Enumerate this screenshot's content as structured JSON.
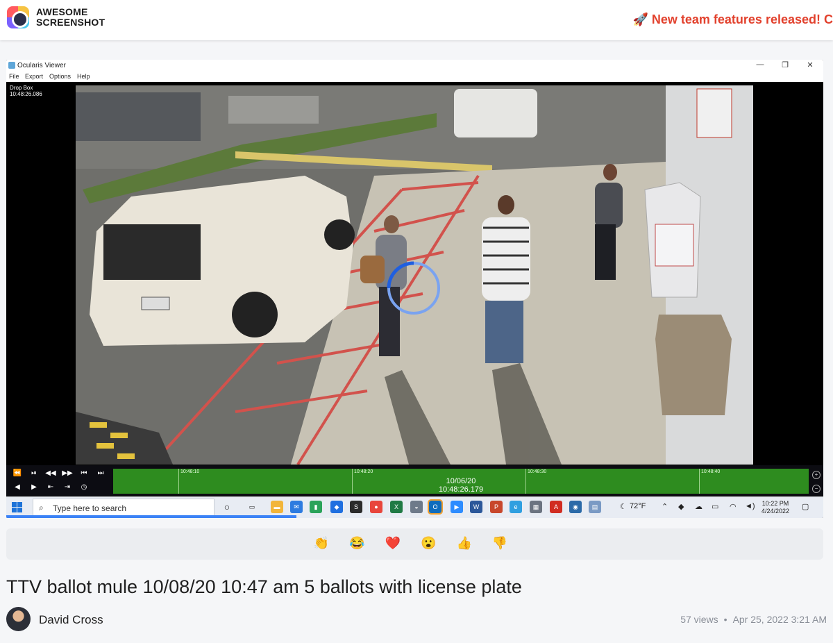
{
  "header": {
    "brand": "AWESOME\nSCREENSHOT",
    "promo": "🚀 New team features released! C"
  },
  "viewer_window": {
    "title": "Ocularis Viewer",
    "menu": [
      "File",
      "Export",
      "Options",
      "Help"
    ],
    "camera_label": "Drop Box\n10:48:26.086",
    "timeline": {
      "ticks": [
        "10:48:10",
        "10:48:20",
        "10:48:30",
        "10:48:40"
      ],
      "current": "10/06/20\n10:48:26.179"
    }
  },
  "taskbar": {
    "search_placeholder": "Type here to search",
    "weather": "72°F",
    "clock": "10:22 PM\n4/24/2022"
  },
  "reactions": [
    "👏",
    "😂",
    "❤️",
    "😮",
    "👍",
    "👎"
  ],
  "video": {
    "title": "TTV ballot mule 10/08/20 10:47 am 5 ballots with license plate",
    "author": "David Cross",
    "views": "57 views",
    "date": "Apr 25, 2022 3:21 AM"
  },
  "colors": {
    "promo": "#e2412d",
    "timeline": "#2e8c1f",
    "taskbar": "#e8ecf3"
  }
}
